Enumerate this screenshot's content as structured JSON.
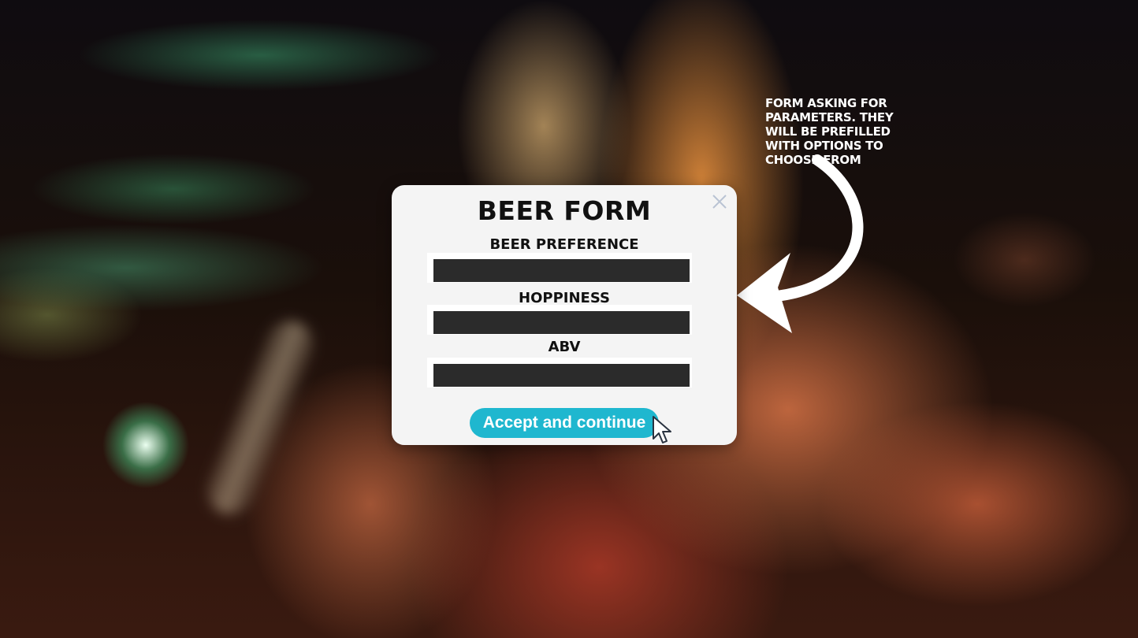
{
  "annotation": {
    "text": "FORM ASKING FOR PARAMETERS. THEY WILL BE PREFILLED WITH OPTIONS TO CHOOSE FROM"
  },
  "form": {
    "title": "BEER FORM",
    "fields": [
      {
        "label": "BEER PREFERENCE",
        "value": ""
      },
      {
        "label": "HOPPINESS",
        "value": ""
      },
      {
        "label": "ABV",
        "value": ""
      }
    ],
    "submit_label": "Accept and continue"
  },
  "colors": {
    "button": "#1fb7cf",
    "modal_bg": "#f4f4f4",
    "field_fill": "#2b2b2b",
    "close_icon": "#b9c3d3"
  },
  "icons": {
    "close": "close-icon",
    "cursor": "mouse-pointer-icon",
    "arrow": "curved-arrow-icon"
  }
}
